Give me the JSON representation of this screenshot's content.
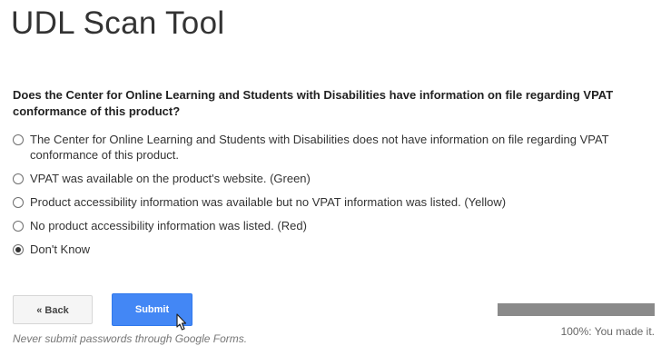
{
  "form": {
    "title": "UDL Scan Tool"
  },
  "question": {
    "text": "Does the Center for Online Learning and Students with Disabilities have information on file regarding VPAT conformance of this product?",
    "options": [
      {
        "label": "The Center for Online Learning and Students with Disabilities does not have information on file regarding VPAT conformance of this product.",
        "selected": false
      },
      {
        "label": "VPAT was available on the product's website. (Green)",
        "selected": false
      },
      {
        "label": "Product accessibility information was available but no VPAT information was listed. (Yellow)",
        "selected": false
      },
      {
        "label": "No product accessibility information was listed. (Red)",
        "selected": false
      },
      {
        "label": "Don't Know",
        "selected": true
      }
    ]
  },
  "navigation": {
    "back_label": "« Back",
    "submit_label": "Submit"
  },
  "footer": {
    "note": "Never submit passwords through Google Forms."
  },
  "progress": {
    "percent": 100,
    "text": "100%: You made it."
  },
  "colors": {
    "submit_button": "#4387f5",
    "progress_fill": "#8a8a8a"
  }
}
